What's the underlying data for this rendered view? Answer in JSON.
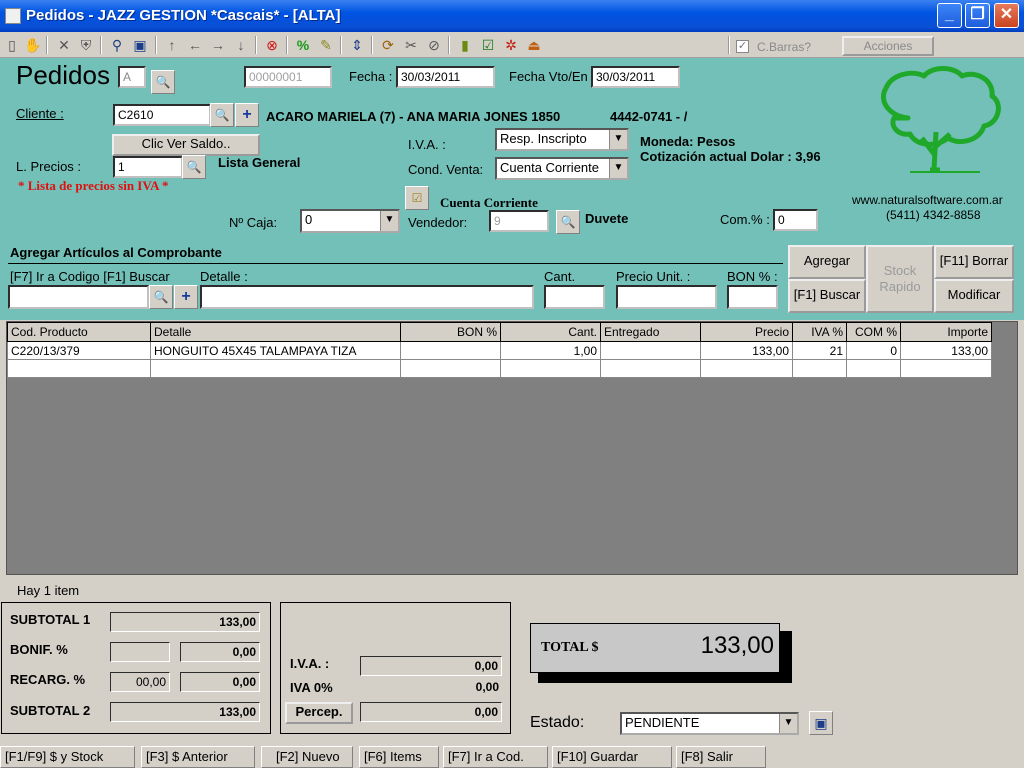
{
  "window": {
    "title": "Pedidos - JAZZ GESTION *Cascais* - [ALTA]"
  },
  "toolbar": {
    "cbarras_label": "C.Barras?",
    "acciones_label": "Acciones"
  },
  "header": {
    "title": "Pedidos",
    "doc_type": "A",
    "doc_number": "00000001",
    "fecha_label": "Fecha :",
    "fecha_value": "30/03/2011",
    "fecha_vto_label": "Fecha Vto/En",
    "fecha_vto_value": "30/03/2011",
    "cliente_label": "Cliente :",
    "cliente_code": "C2610",
    "cliente_info": "ACARO MARIELA (7) - ANA MARIA JONES 1850",
    "cliente_phone": "4442-0741 - /",
    "saldo_button": "Clic Ver Saldo..",
    "iva_label": "I.V.A. :",
    "iva_value": "Resp. Inscripto",
    "moneda": "Moneda: Pesos",
    "cotizacion": "Cotización actual Dolar : 3,96",
    "lprecios_label": "L. Precios :",
    "lprecios_value": "1",
    "lprecios_name": "Lista General",
    "lprecios_note": "* Lista de precios sin IVA *",
    "cond_venta_label": "Cond. Venta:",
    "cond_venta_value": "Cuenta Corriente",
    "cond_venta_text": "Cuenta Corriente",
    "caja_label": "Nº Caja:",
    "caja_value": "0",
    "vendedor_label": "Vendedor:",
    "vendedor_code": "9",
    "vendedor_name": "Duvete",
    "com_label": "Com.% :",
    "com_value": "0",
    "website": "www.naturalsoftware.com.ar",
    "phone": "(5411) 4342-8858"
  },
  "add_section": {
    "title": "Agregar Artículos al Comprobante",
    "codigo_label": "[F7] Ir a Codigo [F1] Buscar",
    "detalle_label": "Detalle :",
    "cant_label": "Cant.",
    "precio_label": "Precio Unit. :",
    "bon_label": "BON % :",
    "agregar_button": "Agregar",
    "stock_button": "Stock Rapido",
    "borrar_button": "[F11] Borrar",
    "buscar_button": "[F1] Buscar",
    "modificar_button": "Modificar"
  },
  "grid": {
    "columns": [
      "Cod. Producto",
      "Detalle",
      "BON %",
      "Cant.",
      "Entregado",
      "Precio",
      "IVA %",
      "COM %",
      "Importe"
    ],
    "rows": [
      [
        "C220/13/379",
        "HONGUITO 45X45 TALAMPAYA TIZA",
        "",
        "1,00",
        "",
        "133,00",
        "21",
        "0",
        "133,00"
      ]
    ]
  },
  "summary": {
    "items_count": "Hay 1 item",
    "subtotal1_label": "SUBTOTAL 1",
    "subtotal1": "133,00",
    "bonif_label": "BONIF. %",
    "bonif_pct": "",
    "bonif_value": "0,00",
    "recarg_label": "RECARG. %",
    "recarg_pct": "00,00",
    "recarg_value": "0,00",
    "subtotal2_label": "SUBTOTAL 2",
    "subtotal2": "133,00",
    "iva_label": "I.V.A. :",
    "iva_value": "0,00",
    "iva0_label": "IVA 0%",
    "iva0_value": "0,00",
    "percep_button": "Percep.",
    "percep_value": "0,00",
    "total_label": "TOTAL $",
    "total_value": "133,00",
    "estado_label": "Estado:",
    "estado_value": "PENDIENTE"
  },
  "statusbar": [
    "[F1/F9] $ y Stock",
    "[F3] $ Anterior",
    "[F2] Nuevo",
    "[F6] Items",
    "[F7] Ir a Cod.",
    "[F10] Guardar",
    "[F8] Salir"
  ],
  "colors": {
    "panel_teal": "#73c0b8",
    "titlebar_blue": "#0054e3",
    "tree_green": "#1fa82a"
  }
}
